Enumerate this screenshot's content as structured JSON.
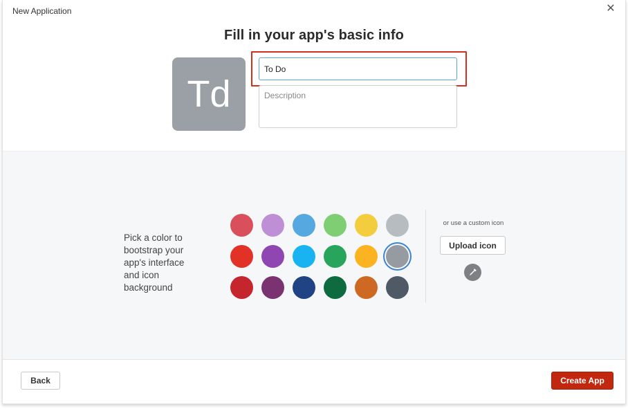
{
  "dialog": {
    "title": "New Application",
    "close_icon": "close-icon",
    "close_glyph": "✕"
  },
  "main": {
    "heading": "Fill in your app's basic info",
    "app_icon_text": "Td",
    "app_icon_color": "#9aa0a6",
    "name_value": "To Do",
    "description_placeholder": "Description"
  },
  "colors": {
    "prompt": "Pick a color to bootstrap your app's interface and icon background",
    "rows": [
      [
        "#d9505c",
        "#bf8fd6",
        "#56a8e1",
        "#7fce73",
        "#f4cd3f",
        "#b7bcc1"
      ],
      [
        "#e23127",
        "#8f45b2",
        "#1ab3f1",
        "#28a45c",
        "#fbb321",
        "#969ba1"
      ],
      [
        "#c5252c",
        "#7a3270",
        "#204384",
        "#0e6a3f",
        "#cd6923",
        "#505a67"
      ]
    ],
    "selected": {
      "row": 1,
      "col": 5
    },
    "selected_ring_color": "#3b82d6"
  },
  "custom_icon": {
    "label": "or use a custom icon",
    "upload_label": "Upload icon",
    "picker_icon": "eyedropper-icon"
  },
  "footer": {
    "back_label": "Back",
    "create_label": "Create App",
    "create_color": "#c2280f"
  }
}
